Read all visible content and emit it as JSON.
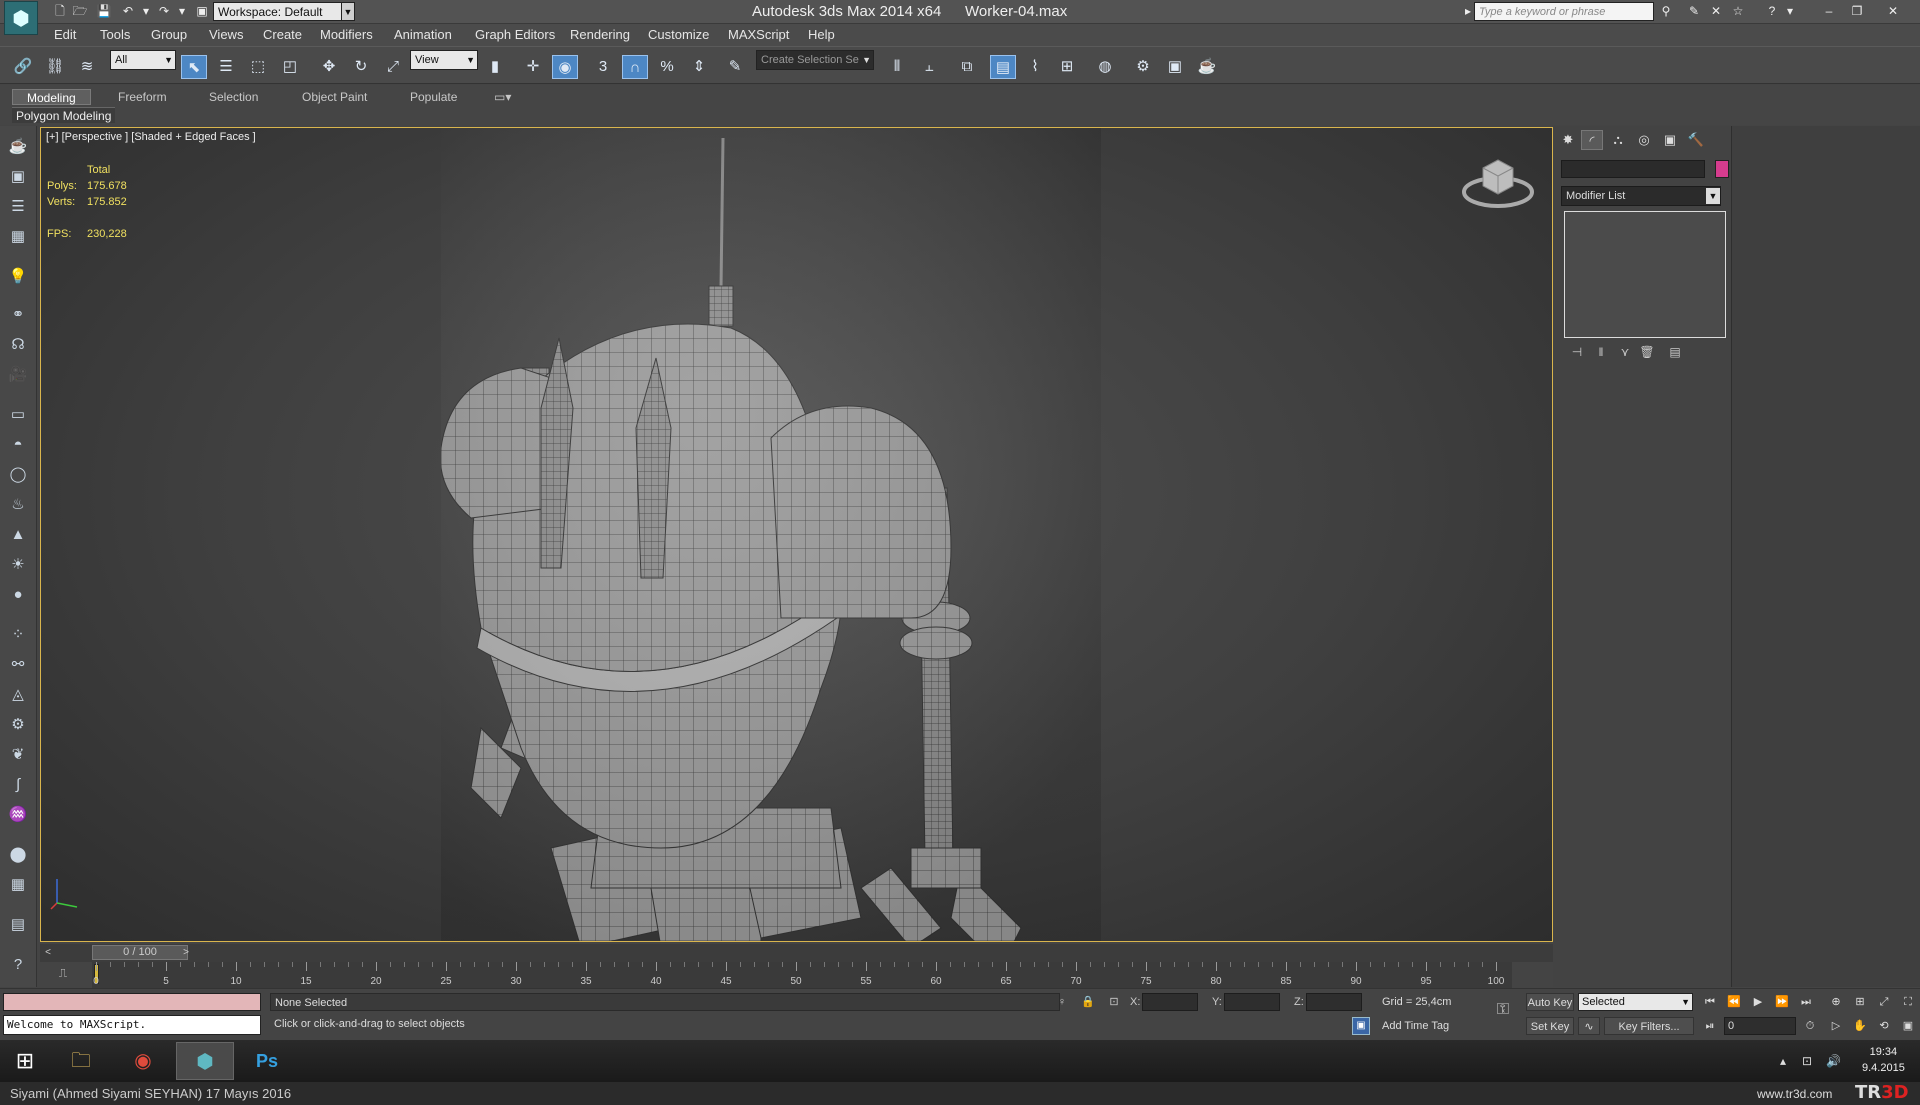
{
  "titlebar": {
    "workspace": "Workspace: Default",
    "app_title": "Autodesk 3ds Max  2014 x64",
    "file_name": "Worker-04.max",
    "search_placeholder": "Type a keyword or phrase"
  },
  "menu": [
    "Edit",
    "Tools",
    "Group",
    "Views",
    "Create",
    "Modifiers",
    "Animation",
    "Graph Editors",
    "Rendering",
    "Customize",
    "MAXScript",
    "Help"
  ],
  "toolbar": {
    "selection_filter": "All",
    "ref_coord": "View",
    "snap_label": "3",
    "angle_snap_label": "%",
    "named_selection": "Create Selection Se"
  },
  "ribbon": {
    "tabs": [
      "Modeling",
      "Freeform",
      "Selection",
      "Object Paint",
      "Populate"
    ],
    "panel": "Polygon Modeling"
  },
  "viewport": {
    "label": "[+] [Perspective ] [Shaded + Edged Faces ]",
    "stats": {
      "header": "Total",
      "polys_label": "Polys:",
      "polys": "175.678",
      "verts_label": "Verts:",
      "verts": "175.852",
      "fps_label": "FPS:",
      "fps": "230,228"
    }
  },
  "command_panel": {
    "modifier_list": "Modifier List",
    "object_color": "#d63c8e"
  },
  "timeline": {
    "slider": "0 / 100",
    "ticks": [
      "0",
      "5",
      "10",
      "15",
      "20",
      "25",
      "30",
      "35",
      "40",
      "45",
      "50",
      "55",
      "60",
      "65",
      "70",
      "75",
      "80",
      "85",
      "90",
      "95",
      "100"
    ]
  },
  "status": {
    "listener": "Welcome to MAXScript.",
    "selection": "None Selected",
    "prompt": "Click or click-and-drag to select objects",
    "x_label": "X:",
    "y_label": "Y:",
    "z_label": "Z:",
    "grid": "Grid = 25,4cm",
    "add_time_tag": "Add Time Tag",
    "auto_key": "Auto Key",
    "set_key": "Set Key",
    "selected": "Selected",
    "key_filters": "Key Filters...",
    "frame": "0"
  },
  "taskbar": {
    "time": "19:34",
    "date": "9.4.2015"
  },
  "caption": {
    "credit": "Siyami (Ahmed Siyami SEYHAN)  17 Mayıs 2016",
    "site": "www.tr3d.com",
    "logo_tr": "TR",
    "logo_3d": "3D"
  }
}
